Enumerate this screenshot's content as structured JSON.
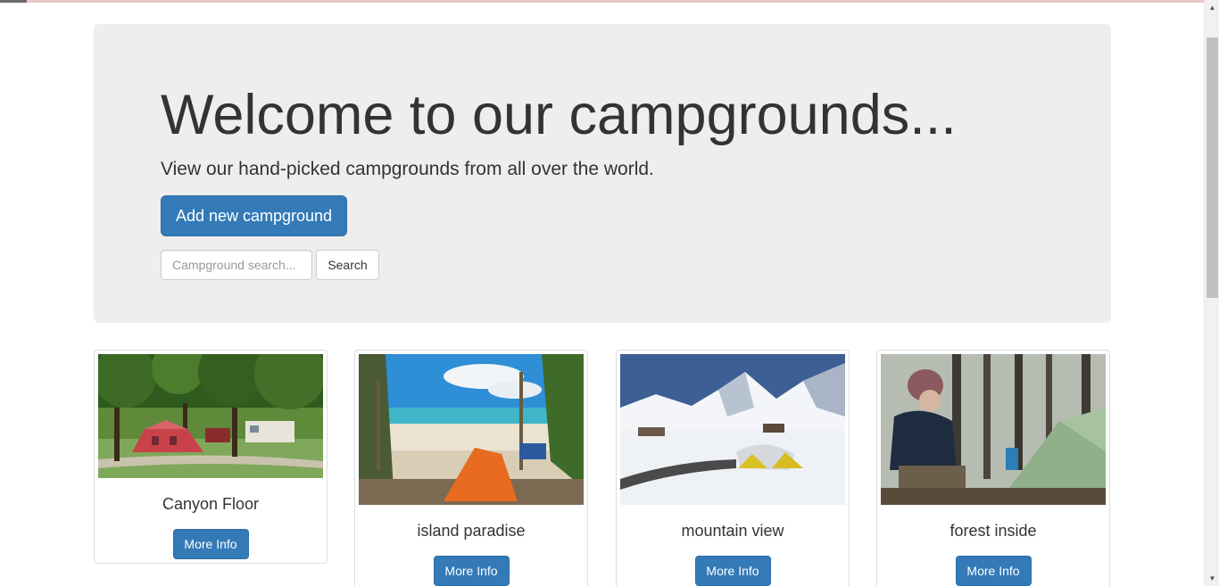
{
  "hero": {
    "title": "Welcome to our campgrounds...",
    "subtitle": "View our hand-picked campgrounds from all over the world.",
    "add_button_label": "Add new campground"
  },
  "search": {
    "placeholder": "Campground search...",
    "button_label": "Search"
  },
  "campgrounds": [
    {
      "name": "Canyon Floor",
      "button_label": "More Info",
      "image": "tent-in-park"
    },
    {
      "name": "island paradise",
      "button_label": "More Info",
      "image": "tent-on-beach"
    },
    {
      "name": "mountain view",
      "button_label": "More Info",
      "image": "tents-in-snowy-mountains"
    },
    {
      "name": "forest inside",
      "button_label": "More Info",
      "image": "camper-in-forest"
    }
  ],
  "colors": {
    "primary": "#337ab7",
    "jumbotron_bg": "#eeeeee",
    "text": "#333333"
  }
}
